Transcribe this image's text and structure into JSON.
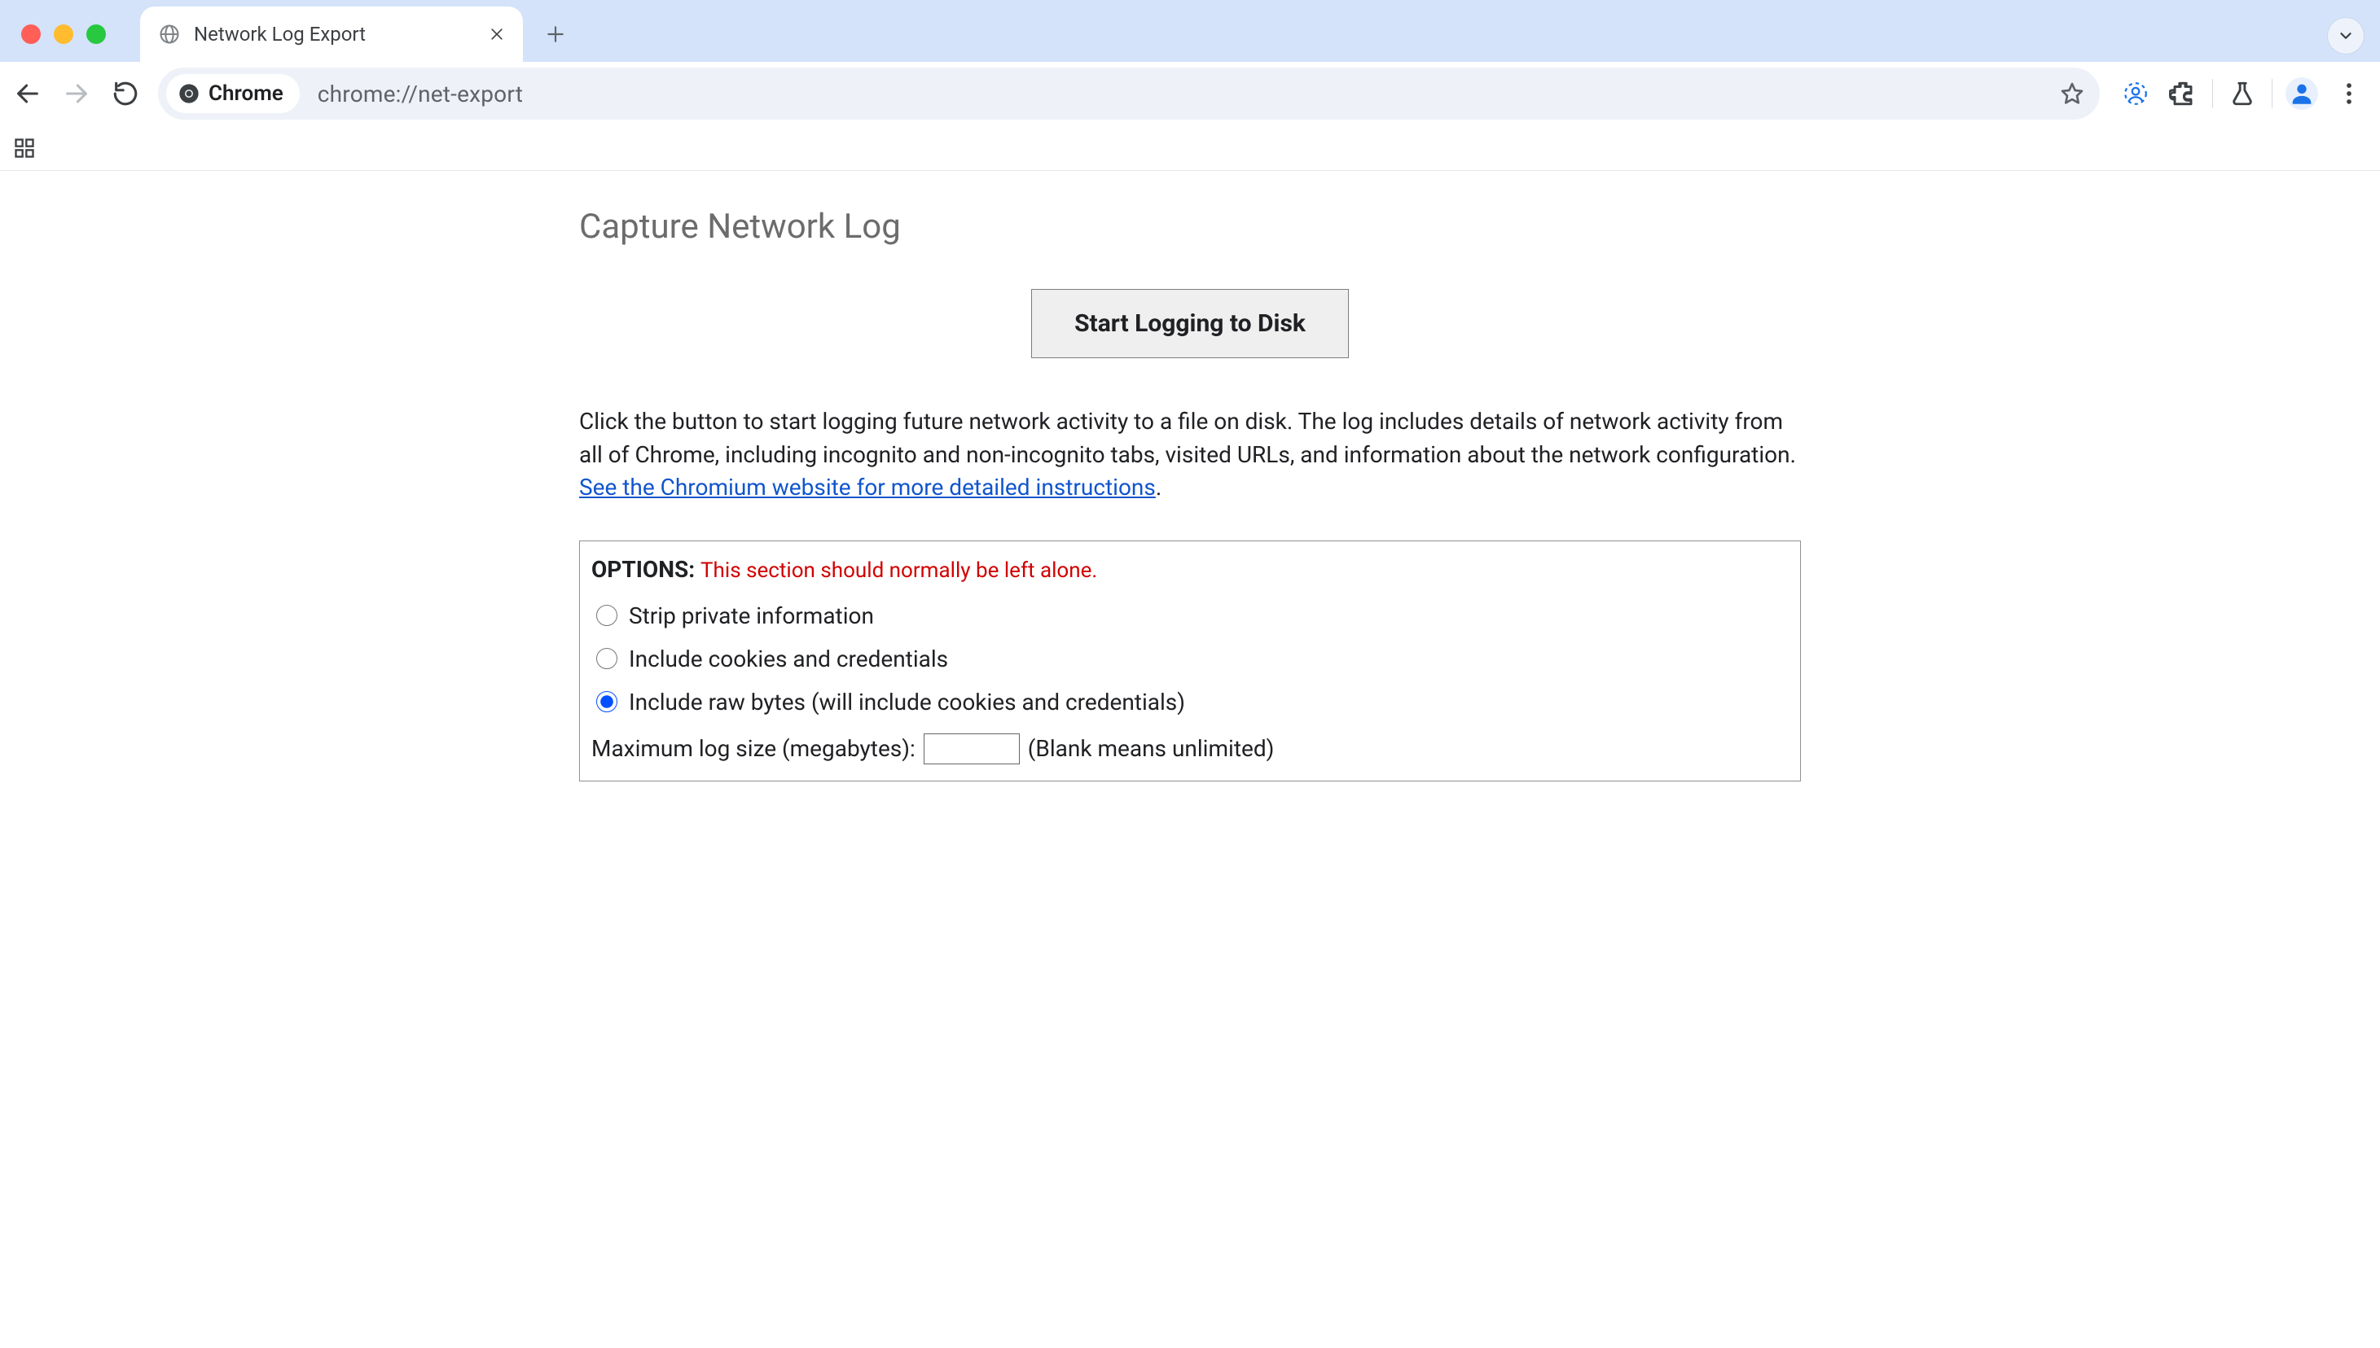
{
  "browser": {
    "tab": {
      "title": "Network Log Export",
      "favicon": "globe-icon"
    },
    "omnibox": {
      "chip_label": "Chrome",
      "url": "chrome://net-export"
    }
  },
  "content": {
    "heading": "Capture Network Log",
    "start_button": "Start Logging to Disk",
    "description_prefix": "Click the button to start logging future network activity to a file on disk. The log includes details of network activity from all of Chrome, including incognito and non-incognito tabs, visited URLs, and information about the network configuration. ",
    "description_link_text": "See the Chromium website for more detailed instructions",
    "description_suffix": ".",
    "options": {
      "header_label": "OPTIONS:",
      "header_warning": "This section should normally be left alone.",
      "radios": [
        {
          "label": "Strip private information",
          "selected": false
        },
        {
          "label": "Include cookies and credentials",
          "selected": false
        },
        {
          "label": "Include raw bytes (will include cookies and credentials)",
          "selected": true
        }
      ],
      "max_size_label": "Maximum log size (megabytes):",
      "max_size_value": "",
      "max_size_note": "(Blank means unlimited)"
    }
  }
}
